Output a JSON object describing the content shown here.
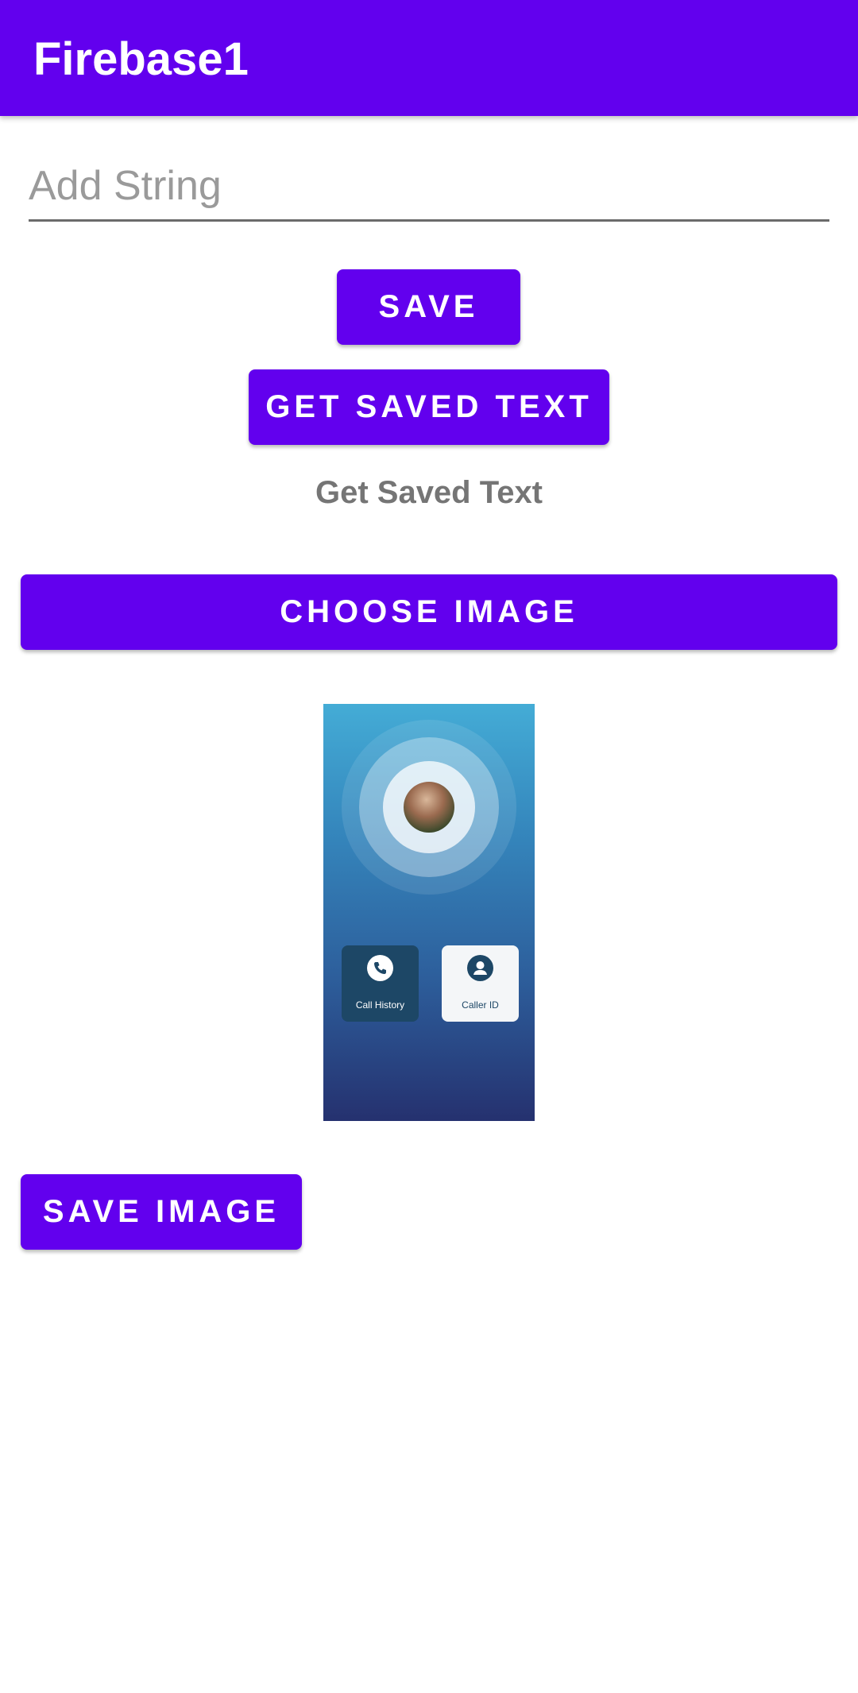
{
  "app_bar": {
    "title": "Firebase1",
    "color": "#6200ee"
  },
  "input": {
    "value": "",
    "placeholder": "Add String"
  },
  "buttons": {
    "save": "SAVE",
    "get_saved_text": "GET SAVED TEXT",
    "choose_image": "CHOOSE IMAGE",
    "save_image": "SAVE IMAGE"
  },
  "saved_text": "Get Saved Text",
  "preview_image": {
    "tiles": [
      {
        "label": "Call History",
        "icon": "phone-icon"
      },
      {
        "label": "Caller ID",
        "icon": "person-icon"
      }
    ]
  }
}
